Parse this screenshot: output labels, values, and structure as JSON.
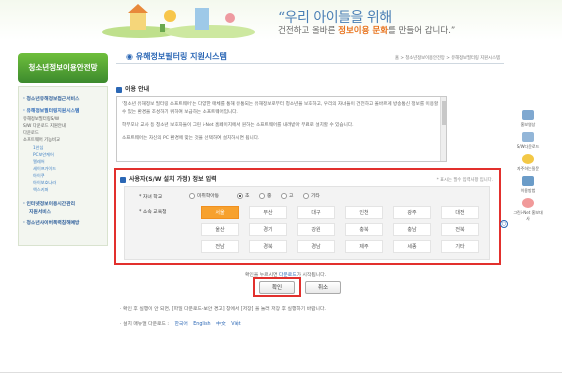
{
  "banner": {
    "slogan_line1": "“우리 아이들을 위해",
    "slogan_line2_prefix": "건전하고 올바른 ",
    "slogan_line2_emph": "정보이용 문화",
    "slogan_line2_suffix": "를 만들어 갑니다.”"
  },
  "sidebar": {
    "logo": "청소년정보이용안전망",
    "items": [
      {
        "label": "청소년유해정보접근서비스"
      },
      {
        "label": "유해정보필터링지원시스템"
      },
      {
        "label": "유해정보필터링S/W"
      },
      {
        "label": "S/W 다운로드 지원안내"
      },
      {
        "label": "다운로드"
      },
      {
        "label": "소프트웨어 기능비교"
      },
      {
        "label": "1안심"
      },
      {
        "label": "PC보안케어"
      },
      {
        "label": "엘레어"
      },
      {
        "label": "세이프가이드"
      },
      {
        "label": "아이쿠"
      },
      {
        "label": "아이보호나라"
      },
      {
        "label": "엑스키퍼"
      },
      {
        "label": "인터넷정보이용시간관리"
      },
      {
        "label": "지원서비스"
      },
      {
        "label": "청소년사이버폭력침해예방"
      }
    ]
  },
  "header": {
    "title": "유해정보필터링 지원시스템",
    "breadcrumb": "홈 > 청소년정보이용안전망 > 유해정보필터링 지원시스템"
  },
  "usage_guide": {
    "heading": "이용 안내",
    "para1": "'청소년 유해정보 필터링 소프트웨어'는 다양한 매체를 통해 유통되는 유해정보로부터 청소년을 보호하고, 우리의 자녀들이 건전하고 올바르게 방송통신 정보를 이용할 수 있는 환경을 조성하기 위하여 보급하는 소프트웨어입니다.",
    "para2": "학부모나 교사 등 청소년 보호자들이 그린 i-Net 홈페이지에서 원하는 소프트웨어를 내려받아 무료로 설치할 수 있습니다.",
    "para3": "소프트웨어는 자신의 PC 환경에 맞는 것을 선택하여 설치하시면 됩니다."
  },
  "user_info": {
    "heading": "사용자(S/W 설치 가정) 정보 입력",
    "hint": "* 표시는 필수 입력사항 입니다.",
    "school_label": "* 자녀 학교",
    "school_options": [
      {
        "label": "미취학아동",
        "checked": false
      },
      {
        "label": "초",
        "checked": true
      },
      {
        "label": "중",
        "checked": false
      },
      {
        "label": "고",
        "checked": false
      },
      {
        "label": "기타",
        "checked": false
      }
    ],
    "region_label": "* 소속 교육청",
    "regions": [
      "서울",
      "부산",
      "대구",
      "인천",
      "광주",
      "대전",
      "울산",
      "경기",
      "강원",
      "충북",
      "충남",
      "전북",
      "전남",
      "경북",
      "경남",
      "제주",
      "세종",
      "기타"
    ],
    "selected_region": "서울"
  },
  "actions": {
    "notice_prefix": "확인을 누르시면 ",
    "notice_emph": "다운로드",
    "notice_suffix": "가 시작됩니다.",
    "confirm_label": "확인",
    "cancel_label": "취소"
  },
  "footer_notes": {
    "note1": "· 확인 후 실행이 안 되면, [파일 다운로드-보안 경고] 창에서 [저장] 을 눌러 저장 후 실행하기 바랍니다.",
    "manual_label": "· 설치 매뉴얼 다운로드 :",
    "manual_langs": [
      "한국어",
      "English",
      "中文",
      "Việt"
    ]
  },
  "quick_menu": {
    "items": [
      {
        "label": "홍보영상"
      },
      {
        "label": "S/W다운로드"
      },
      {
        "label": "자주하는질문"
      },
      {
        "label": "이용방법"
      },
      {
        "label": "그린i-Net 홍보대사"
      }
    ]
  }
}
